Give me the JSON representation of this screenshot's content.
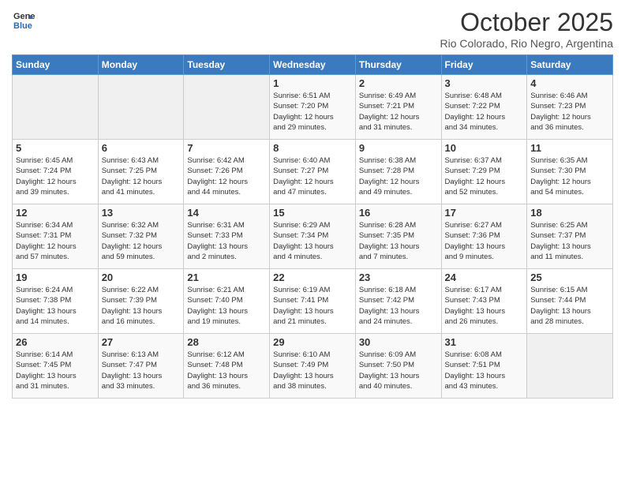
{
  "logo": {
    "general": "General",
    "blue": "Blue"
  },
  "header": {
    "month": "October 2025",
    "location": "Rio Colorado, Rio Negro, Argentina"
  },
  "weekdays": [
    "Sunday",
    "Monday",
    "Tuesday",
    "Wednesday",
    "Thursday",
    "Friday",
    "Saturday"
  ],
  "weeks": [
    [
      {
        "day": "",
        "info": ""
      },
      {
        "day": "",
        "info": ""
      },
      {
        "day": "",
        "info": ""
      },
      {
        "day": "1",
        "info": "Sunrise: 6:51 AM\nSunset: 7:20 PM\nDaylight: 12 hours\nand 29 minutes."
      },
      {
        "day": "2",
        "info": "Sunrise: 6:49 AM\nSunset: 7:21 PM\nDaylight: 12 hours\nand 31 minutes."
      },
      {
        "day": "3",
        "info": "Sunrise: 6:48 AM\nSunset: 7:22 PM\nDaylight: 12 hours\nand 34 minutes."
      },
      {
        "day": "4",
        "info": "Sunrise: 6:46 AM\nSunset: 7:23 PM\nDaylight: 12 hours\nand 36 minutes."
      }
    ],
    [
      {
        "day": "5",
        "info": "Sunrise: 6:45 AM\nSunset: 7:24 PM\nDaylight: 12 hours\nand 39 minutes."
      },
      {
        "day": "6",
        "info": "Sunrise: 6:43 AM\nSunset: 7:25 PM\nDaylight: 12 hours\nand 41 minutes."
      },
      {
        "day": "7",
        "info": "Sunrise: 6:42 AM\nSunset: 7:26 PM\nDaylight: 12 hours\nand 44 minutes."
      },
      {
        "day": "8",
        "info": "Sunrise: 6:40 AM\nSunset: 7:27 PM\nDaylight: 12 hours\nand 47 minutes."
      },
      {
        "day": "9",
        "info": "Sunrise: 6:38 AM\nSunset: 7:28 PM\nDaylight: 12 hours\nand 49 minutes."
      },
      {
        "day": "10",
        "info": "Sunrise: 6:37 AM\nSunset: 7:29 PM\nDaylight: 12 hours\nand 52 minutes."
      },
      {
        "day": "11",
        "info": "Sunrise: 6:35 AM\nSunset: 7:30 PM\nDaylight: 12 hours\nand 54 minutes."
      }
    ],
    [
      {
        "day": "12",
        "info": "Sunrise: 6:34 AM\nSunset: 7:31 PM\nDaylight: 12 hours\nand 57 minutes."
      },
      {
        "day": "13",
        "info": "Sunrise: 6:32 AM\nSunset: 7:32 PM\nDaylight: 12 hours\nand 59 minutes."
      },
      {
        "day": "14",
        "info": "Sunrise: 6:31 AM\nSunset: 7:33 PM\nDaylight: 13 hours\nand 2 minutes."
      },
      {
        "day": "15",
        "info": "Sunrise: 6:29 AM\nSunset: 7:34 PM\nDaylight: 13 hours\nand 4 minutes."
      },
      {
        "day": "16",
        "info": "Sunrise: 6:28 AM\nSunset: 7:35 PM\nDaylight: 13 hours\nand 7 minutes."
      },
      {
        "day": "17",
        "info": "Sunrise: 6:27 AM\nSunset: 7:36 PM\nDaylight: 13 hours\nand 9 minutes."
      },
      {
        "day": "18",
        "info": "Sunrise: 6:25 AM\nSunset: 7:37 PM\nDaylight: 13 hours\nand 11 minutes."
      }
    ],
    [
      {
        "day": "19",
        "info": "Sunrise: 6:24 AM\nSunset: 7:38 PM\nDaylight: 13 hours\nand 14 minutes."
      },
      {
        "day": "20",
        "info": "Sunrise: 6:22 AM\nSunset: 7:39 PM\nDaylight: 13 hours\nand 16 minutes."
      },
      {
        "day": "21",
        "info": "Sunrise: 6:21 AM\nSunset: 7:40 PM\nDaylight: 13 hours\nand 19 minutes."
      },
      {
        "day": "22",
        "info": "Sunrise: 6:19 AM\nSunset: 7:41 PM\nDaylight: 13 hours\nand 21 minutes."
      },
      {
        "day": "23",
        "info": "Sunrise: 6:18 AM\nSunset: 7:42 PM\nDaylight: 13 hours\nand 24 minutes."
      },
      {
        "day": "24",
        "info": "Sunrise: 6:17 AM\nSunset: 7:43 PM\nDaylight: 13 hours\nand 26 minutes."
      },
      {
        "day": "25",
        "info": "Sunrise: 6:15 AM\nSunset: 7:44 PM\nDaylight: 13 hours\nand 28 minutes."
      }
    ],
    [
      {
        "day": "26",
        "info": "Sunrise: 6:14 AM\nSunset: 7:45 PM\nDaylight: 13 hours\nand 31 minutes."
      },
      {
        "day": "27",
        "info": "Sunrise: 6:13 AM\nSunset: 7:47 PM\nDaylight: 13 hours\nand 33 minutes."
      },
      {
        "day": "28",
        "info": "Sunrise: 6:12 AM\nSunset: 7:48 PM\nDaylight: 13 hours\nand 36 minutes."
      },
      {
        "day": "29",
        "info": "Sunrise: 6:10 AM\nSunset: 7:49 PM\nDaylight: 13 hours\nand 38 minutes."
      },
      {
        "day": "30",
        "info": "Sunrise: 6:09 AM\nSunset: 7:50 PM\nDaylight: 13 hours\nand 40 minutes."
      },
      {
        "day": "31",
        "info": "Sunrise: 6:08 AM\nSunset: 7:51 PM\nDaylight: 13 hours\nand 43 minutes."
      },
      {
        "day": "",
        "info": ""
      }
    ]
  ]
}
